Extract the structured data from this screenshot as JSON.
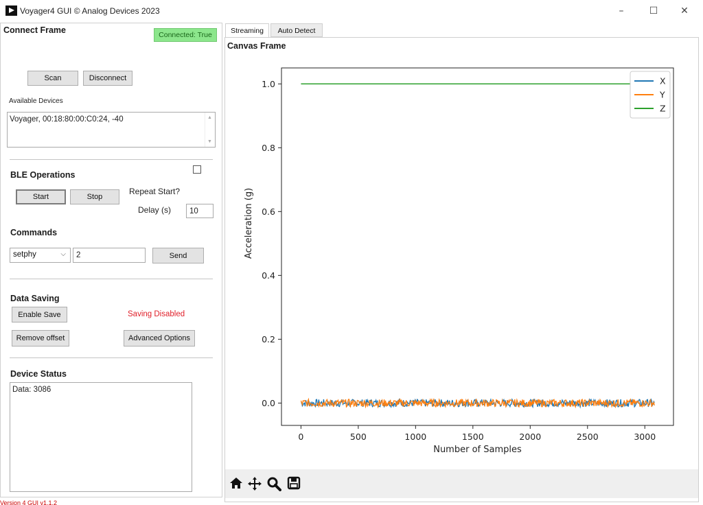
{
  "window": {
    "title": "Voyager4 GUI © Analog Devices 2023",
    "minimize": "–",
    "maximize": "☐",
    "close": "✕"
  },
  "connect": {
    "heading": "Connect Frame",
    "status": "Connected: True",
    "scan_label": "Scan",
    "disconnect_label": "Disconnect",
    "devices_label": "Available Devices",
    "devices": [
      "Voyager, 00:18:80:00:C0:24, -40"
    ]
  },
  "ble": {
    "heading": "BLE Operations",
    "start_label": "Start",
    "stop_label": "Stop",
    "repeat_label": "Repeat Start?",
    "repeat_checked": false,
    "delay_label": "Delay (s)",
    "delay_value": "10"
  },
  "commands": {
    "heading": "Commands",
    "selected": "setphy",
    "arg_value": "2",
    "send_label": "Send"
  },
  "saving": {
    "heading": "Data Saving",
    "enable_label": "Enable Save",
    "status": "Saving Disabled",
    "status_color": "#e0202a",
    "remove_offset_label": "Remove offset",
    "advanced_label": "Advanced Options"
  },
  "device_status": {
    "heading": "Device Status",
    "text": "Data: 3086"
  },
  "tabs": [
    {
      "label": "Streaming",
      "active": true
    },
    {
      "label": "Auto Detect",
      "active": false
    }
  ],
  "canvas": {
    "heading": "Canvas Frame"
  },
  "toolbar": {
    "icons": [
      "home-icon",
      "pan-icon",
      "zoom-icon",
      "save-icon"
    ]
  },
  "footer": {
    "text": "Version 4 GUI v1.1.2"
  },
  "chart_data": {
    "type": "line",
    "title": "",
    "xlabel": "Number of Samples",
    "ylabel": "Acceleration (g)",
    "xlim": [
      -170,
      3250
    ],
    "ylim": [
      -0.07,
      1.05
    ],
    "xticks": [
      0,
      500,
      1000,
      1500,
      2000,
      2500,
      3000
    ],
    "yticks": [
      0.0,
      0.2,
      0.4,
      0.6,
      0.8,
      1.0
    ],
    "legend_position": "top-right",
    "grid": false,
    "n_samples": 3086,
    "series": [
      {
        "name": "X",
        "color": "#1f77b4",
        "baseline": 0.0,
        "noise": 0.012
      },
      {
        "name": "Y",
        "color": "#ff7f0e",
        "baseline": 0.0,
        "noise": 0.012
      },
      {
        "name": "Z",
        "color": "#2ca02c",
        "baseline": 1.0,
        "noise": 0.0
      }
    ]
  }
}
